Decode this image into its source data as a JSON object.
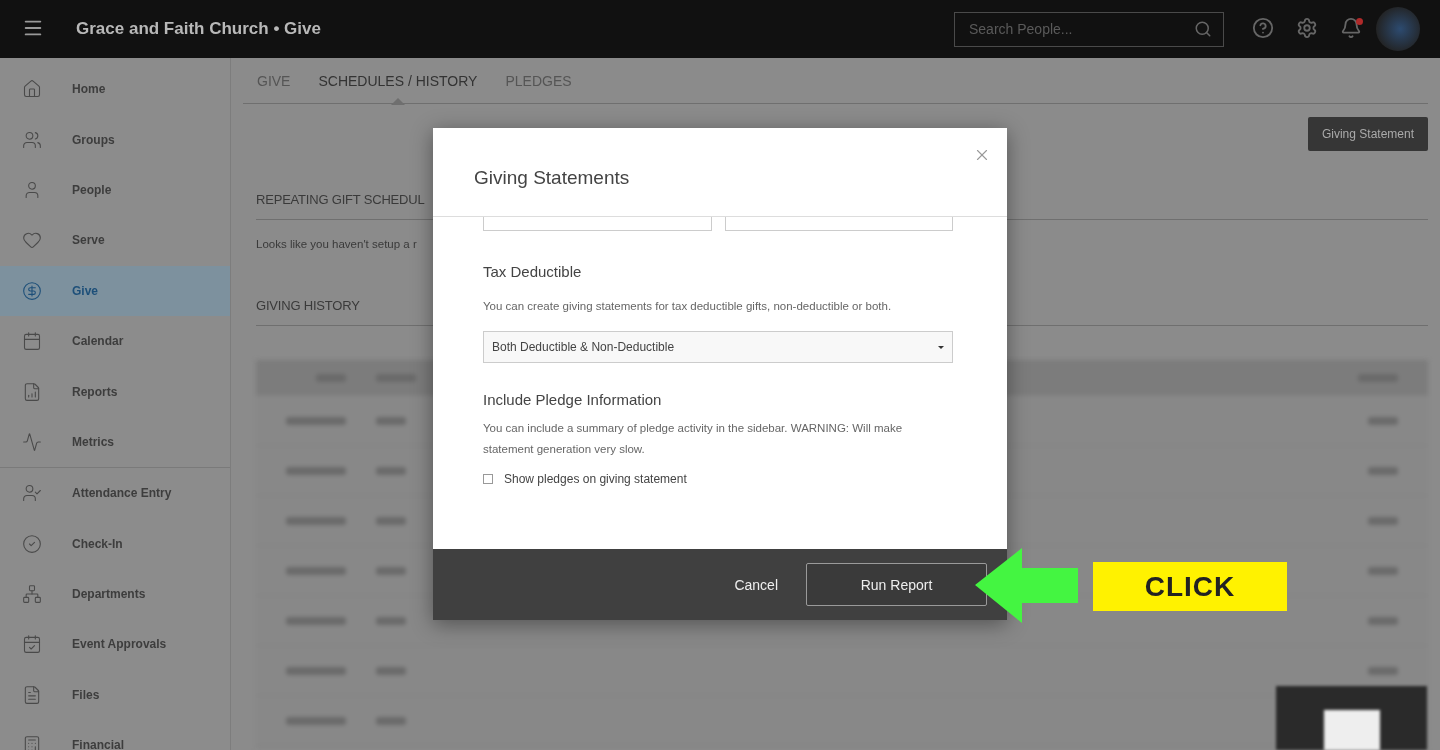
{
  "header": {
    "title": "Grace and Faith Church • Give",
    "search": {
      "placeholder": "Search People..."
    },
    "notification_badge": true
  },
  "sidebar": {
    "sections": [
      {
        "items": [
          {
            "label": "Home",
            "kind": "home",
            "selected": false
          },
          {
            "label": "Groups",
            "kind": "groups",
            "selected": false
          },
          {
            "label": "People",
            "kind": "people",
            "selected": false
          },
          {
            "label": "Serve",
            "kind": "heart",
            "selected": false
          },
          {
            "label": "Give",
            "kind": "dollar",
            "selected": true
          },
          {
            "label": "Calendar",
            "kind": "calendar",
            "selected": false
          },
          {
            "label": "Reports",
            "kind": "report",
            "selected": false
          },
          {
            "label": "Metrics",
            "kind": "metrics",
            "selected": false
          }
        ]
      },
      {
        "items": [
          {
            "label": "Attendance Entry",
            "kind": "attendance",
            "selected": false
          },
          {
            "label": "Check-In",
            "kind": "check",
            "selected": false
          },
          {
            "label": "Departments",
            "kind": "departments",
            "selected": false
          },
          {
            "label": "Event Approvals",
            "kind": "event",
            "selected": false
          },
          {
            "label": "Files",
            "kind": "file",
            "selected": false
          },
          {
            "label": "Financial",
            "kind": "calculator",
            "selected": false
          }
        ]
      }
    ]
  },
  "tabs": [
    {
      "label": "GIVE",
      "selected": false
    },
    {
      "label": "SCHEDULES / HISTORY",
      "selected": true
    },
    {
      "label": "PLEDGES",
      "selected": false
    }
  ],
  "toolbar_button": "Giving Statement",
  "sections": [
    {
      "title": "REPEATING GIFT SCHEDUL",
      "text": "Looks like you haven't setup a r"
    },
    {
      "title": "GIVING HISTORY"
    }
  ],
  "modal": {
    "title": "Giving Statements",
    "groups": [
      {
        "title": "Tax Deductible",
        "description": "You can create giving statements for tax deductible gifts, non-deductible or both.",
        "kind": "select",
        "value": "Both Deductible & Non-Deductible"
      },
      {
        "title": "Include Pledge Information",
        "description": "You can include a summary of pledge activity in the sidebar. WARNING: Will make statement generation very slow.",
        "kind": "checkbox",
        "option": "Show pledges on giving statement",
        "checked": false
      }
    ],
    "cancel": "Cancel",
    "submit": "Run Report"
  },
  "callout": {
    "label": "CLICK"
  }
}
